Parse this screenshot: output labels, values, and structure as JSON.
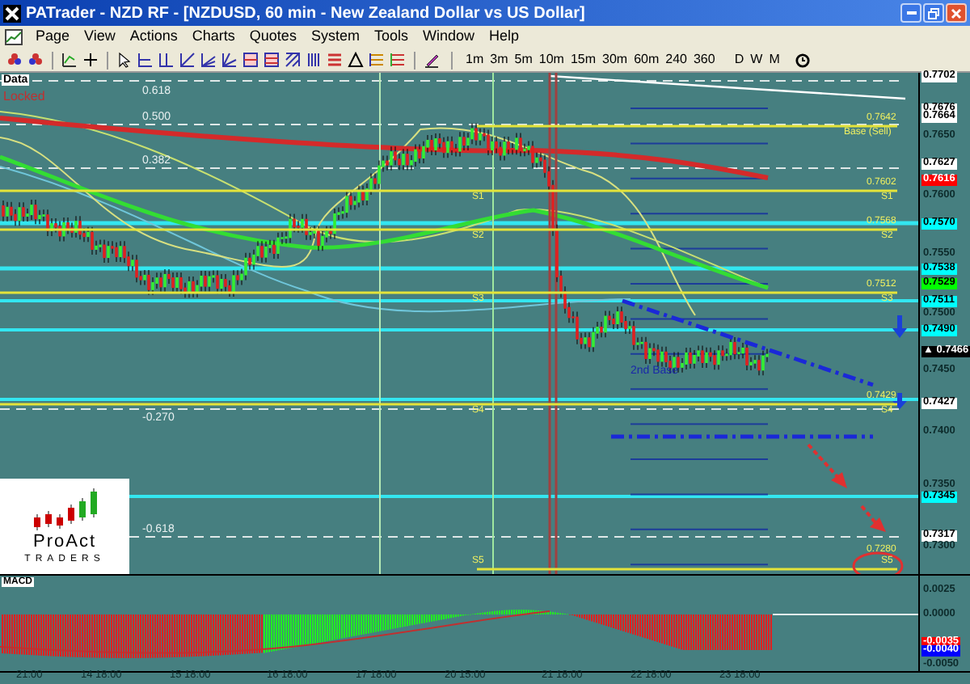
{
  "window": {
    "title": "PATrader - NZD RF - [NZDUSD, 60 min - New Zealand Dollar vs US Dollar]"
  },
  "menu": [
    "Page",
    "View",
    "Actions",
    "Charts",
    "Quotes",
    "System",
    "Tools",
    "Window",
    "Help"
  ],
  "timeframes": [
    "1m",
    "3m",
    "5m",
    "10m",
    "15m",
    "30m",
    "60m",
    "240",
    "360",
    "D",
    "W",
    "M"
  ],
  "chart": {
    "data_tab": "Data",
    "status": "Locked",
    "fib_labels": [
      "0.618",
      "0.500",
      "0.382",
      "-0.270",
      "-0.618"
    ],
    "levels": [
      {
        "price": "0.7642",
        "tag": "Base (Sell)"
      },
      {
        "price": "0.7602",
        "tag": "S1",
        "left_tag": "S1"
      },
      {
        "price": "0.7568",
        "tag": "S2",
        "left_tag": "S2"
      },
      {
        "price": "0.7512",
        "tag": "S3",
        "left_tag": "S3"
      },
      {
        "price": "0.7429",
        "tag": "S4",
        "left_tag": "S4"
      },
      {
        "price": "0.7280",
        "tag": "S5",
        "left_tag": "S5"
      }
    ],
    "pattern_label": "2nd Base",
    "logo": {
      "name": "ProAct",
      "subtitle": "TRADERS"
    }
  },
  "price_axis": [
    {
      "label": "0.7702",
      "color": "#ffffff"
    },
    {
      "label": "0.7676",
      "color": "#ffffff"
    },
    {
      "label": "0.7664",
      "color": "#ffffff"
    },
    {
      "label": "0.7650"
    },
    {
      "label": "0.7627",
      "color": "#ffffff"
    },
    {
      "label": "0.7616",
      "color": "#ff0000"
    },
    {
      "label": "0.7600"
    },
    {
      "label": "0.7570",
      "color": "#00ffff"
    },
    {
      "label": "0.7550"
    },
    {
      "label": "0.7538",
      "color": "#00ffff"
    },
    {
      "label": "0.7529",
      "color": "#00ff00"
    },
    {
      "label": "0.7511",
      "color": "#00ffff"
    },
    {
      "label": "0.7500"
    },
    {
      "label": "0.7490",
      "color": "#00ffff"
    },
    {
      "label": "▲ 0.7466",
      "color": "#000000"
    },
    {
      "label": "0.7450"
    },
    {
      "label": "0.7427",
      "color": "#ffffff"
    },
    {
      "label": "0.7400"
    },
    {
      "label": "0.7350"
    },
    {
      "label": "0.7345",
      "color": "#00ffff"
    },
    {
      "label": "0.7317",
      "color": "#ffffff"
    },
    {
      "label": "0.7300"
    }
  ],
  "macd": {
    "title": "MACD",
    "axis": [
      {
        "label": "0.0025"
      },
      {
        "label": "0.0000"
      },
      {
        "label": "-0.0035",
        "color": "#ff0000"
      },
      {
        "label": "-0.0040",
        "color": "#0000ff"
      },
      {
        "label": "-0.0050"
      }
    ]
  },
  "time_axis": [
    "21:00",
    "14 18:00",
    "15 18:00",
    "16 18:00",
    "17 18:00",
    "20 15:00",
    "21 18:00",
    "22 18:00",
    "23 18:00"
  ]
}
